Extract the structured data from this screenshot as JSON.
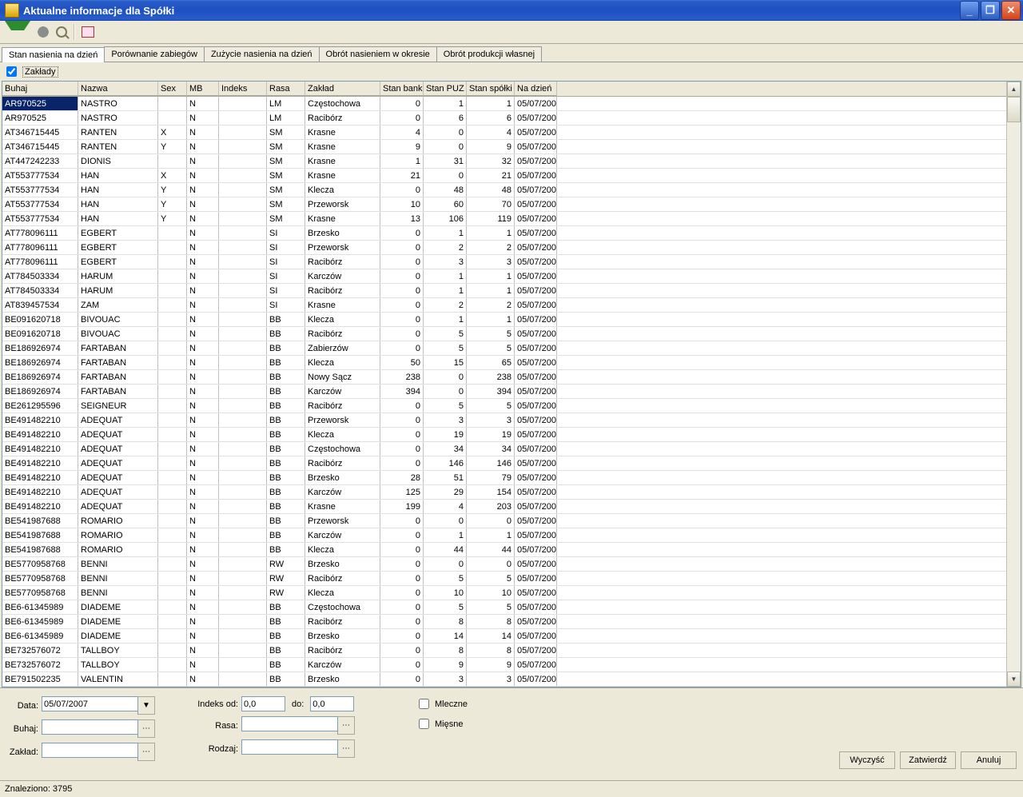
{
  "title": "Aktualne informacje dla Spółki",
  "tabs": [
    "Stan nasienia na dzień",
    "Porównanie zabiegów",
    "Zużycie nasienia na dzień",
    "Obrót nasieniem w okresie",
    "Obrót produkcji własnej"
  ],
  "active_tab": 0,
  "zaklady_checkbox": {
    "label": "Zakłady",
    "checked": true
  },
  "columns": [
    "Buhaj",
    "Nazwa",
    "Sex",
    "MB",
    "Indeks",
    "Rasa",
    "Zakład",
    "Stan bank",
    "Stan PUZ",
    "Stan spółki",
    "Na dzień"
  ],
  "rows": [
    [
      "AR970525",
      "NASTRO",
      "",
      "N",
      "",
      "LM",
      "Częstochowa",
      "0",
      "1",
      "1",
      "05/07/200"
    ],
    [
      "AR970525",
      "NASTRO",
      "",
      "N",
      "",
      "LM",
      "Racibórz",
      "0",
      "6",
      "6",
      "05/07/200"
    ],
    [
      "AT346715445",
      "RANTEN",
      "X",
      "N",
      "",
      "SM",
      "Krasne",
      "4",
      "0",
      "4",
      "05/07/200"
    ],
    [
      "AT346715445",
      "RANTEN",
      "Y",
      "N",
      "",
      "SM",
      "Krasne",
      "9",
      "0",
      "9",
      "05/07/200"
    ],
    [
      "AT447242233",
      "DIONIS",
      "",
      "N",
      "",
      "SM",
      "Krasne",
      "1",
      "31",
      "32",
      "05/07/200"
    ],
    [
      "AT553777534",
      "HAN",
      "X",
      "N",
      "",
      "SM",
      "Krasne",
      "21",
      "0",
      "21",
      "05/07/200"
    ],
    [
      "AT553777534",
      "HAN",
      "Y",
      "N",
      "",
      "SM",
      "Klecza",
      "0",
      "48",
      "48",
      "05/07/200"
    ],
    [
      "AT553777534",
      "HAN",
      "Y",
      "N",
      "",
      "SM",
      "Przeworsk",
      "10",
      "60",
      "70",
      "05/07/200"
    ],
    [
      "AT553777534",
      "HAN",
      "Y",
      "N",
      "",
      "SM",
      "Krasne",
      "13",
      "106",
      "119",
      "05/07/200"
    ],
    [
      "AT778096111",
      "EGBERT",
      "",
      "N",
      "",
      "SI",
      "Brzesko",
      "0",
      "1",
      "1",
      "05/07/200"
    ],
    [
      "AT778096111",
      "EGBERT",
      "",
      "N",
      "",
      "SI",
      "Przeworsk",
      "0",
      "2",
      "2",
      "05/07/200"
    ],
    [
      "AT778096111",
      "EGBERT",
      "",
      "N",
      "",
      "SI",
      "Racibórz",
      "0",
      "3",
      "3",
      "05/07/200"
    ],
    [
      "AT784503334",
      "HARUM",
      "",
      "N",
      "",
      "SI",
      "Karczów",
      "0",
      "1",
      "1",
      "05/07/200"
    ],
    [
      "AT784503334",
      "HARUM",
      "",
      "N",
      "",
      "SI",
      "Racibórz",
      "0",
      "1",
      "1",
      "05/07/200"
    ],
    [
      "AT839457534",
      "ZAM",
      "",
      "N",
      "",
      "SI",
      "Krasne",
      "0",
      "2",
      "2",
      "05/07/200"
    ],
    [
      "BE091620718",
      "BIVOUAC",
      "",
      "N",
      "",
      "BB",
      "Klecza",
      "0",
      "1",
      "1",
      "05/07/200"
    ],
    [
      "BE091620718",
      "BIVOUAC",
      "",
      "N",
      "",
      "BB",
      "Racibórz",
      "0",
      "5",
      "5",
      "05/07/200"
    ],
    [
      "BE186926974",
      "FARTABAN",
      "",
      "N",
      "",
      "BB",
      "Zabierzów",
      "0",
      "5",
      "5",
      "05/07/200"
    ],
    [
      "BE186926974",
      "FARTABAN",
      "",
      "N",
      "",
      "BB",
      "Klecza",
      "50",
      "15",
      "65",
      "05/07/200"
    ],
    [
      "BE186926974",
      "FARTABAN",
      "",
      "N",
      "",
      "BB",
      "Nowy Sącz",
      "238",
      "0",
      "238",
      "05/07/200"
    ],
    [
      "BE186926974",
      "FARTABAN",
      "",
      "N",
      "",
      "BB",
      "Karczów",
      "394",
      "0",
      "394",
      "05/07/200"
    ],
    [
      "BE261295596",
      "SEIGNEUR",
      "",
      "N",
      "",
      "BB",
      "Racibórz",
      "0",
      "5",
      "5",
      "05/07/200"
    ],
    [
      "BE491482210",
      "ADEQUAT",
      "",
      "N",
      "",
      "BB",
      "Przeworsk",
      "0",
      "3",
      "3",
      "05/07/200"
    ],
    [
      "BE491482210",
      "ADEQUAT",
      "",
      "N",
      "",
      "BB",
      "Klecza",
      "0",
      "19",
      "19",
      "05/07/200"
    ],
    [
      "BE491482210",
      "ADEQUAT",
      "",
      "N",
      "",
      "BB",
      "Częstochowa",
      "0",
      "34",
      "34",
      "05/07/200"
    ],
    [
      "BE491482210",
      "ADEQUAT",
      "",
      "N",
      "",
      "BB",
      "Racibórz",
      "0",
      "146",
      "146",
      "05/07/200"
    ],
    [
      "BE491482210",
      "ADEQUAT",
      "",
      "N",
      "",
      "BB",
      "Brzesko",
      "28",
      "51",
      "79",
      "05/07/200"
    ],
    [
      "BE491482210",
      "ADEQUAT",
      "",
      "N",
      "",
      "BB",
      "Karczów",
      "125",
      "29",
      "154",
      "05/07/200"
    ],
    [
      "BE491482210",
      "ADEQUAT",
      "",
      "N",
      "",
      "BB",
      "Krasne",
      "199",
      "4",
      "203",
      "05/07/200"
    ],
    [
      "BE541987688",
      "ROMARIO",
      "",
      "N",
      "",
      "BB",
      "Przeworsk",
      "0",
      "0",
      "0",
      "05/07/200"
    ],
    [
      "BE541987688",
      "ROMARIO",
      "",
      "N",
      "",
      "BB",
      "Karczów",
      "0",
      "1",
      "1",
      "05/07/200"
    ],
    [
      "BE541987688",
      "ROMARIO",
      "",
      "N",
      "",
      "BB",
      "Klecza",
      "0",
      "44",
      "44",
      "05/07/200"
    ],
    [
      "BE5770958768",
      "BENNI",
      "",
      "N",
      "",
      "RW",
      "Brzesko",
      "0",
      "0",
      "0",
      "05/07/200"
    ],
    [
      "BE5770958768",
      "BENNI",
      "",
      "N",
      "",
      "RW",
      "Racibórz",
      "0",
      "5",
      "5",
      "05/07/200"
    ],
    [
      "BE5770958768",
      "BENNI",
      "",
      "N",
      "",
      "RW",
      "Klecza",
      "0",
      "10",
      "10",
      "05/07/200"
    ],
    [
      "BE6-61345989",
      "DIADEME",
      "",
      "N",
      "",
      "BB",
      "Częstochowa",
      "0",
      "5",
      "5",
      "05/07/200"
    ],
    [
      "BE6-61345989",
      "DIADEME",
      "",
      "N",
      "",
      "BB",
      "Racibórz",
      "0",
      "8",
      "8",
      "05/07/200"
    ],
    [
      "BE6-61345989",
      "DIADEME",
      "",
      "N",
      "",
      "BB",
      "Brzesko",
      "0",
      "14",
      "14",
      "05/07/200"
    ],
    [
      "BE732576072",
      "TALLBOY",
      "",
      "N",
      "",
      "BB",
      "Racibórz",
      "0",
      "8",
      "8",
      "05/07/200"
    ],
    [
      "BE732576072",
      "TALLBOY",
      "",
      "N",
      "",
      "BB",
      "Karczów",
      "0",
      "9",
      "9",
      "05/07/200"
    ],
    [
      "BE791502235",
      "VALENTIN",
      "",
      "N",
      "",
      "BB",
      "Brzesko",
      "0",
      "3",
      "3",
      "05/07/200"
    ]
  ],
  "filters": {
    "data_label": "Data:",
    "data_value": "05/07/2007",
    "buhaj_label": "Buhaj:",
    "buhaj_value": "",
    "zaklad_label": "Zakład:",
    "zaklad_value": "",
    "indeks_od_label": "Indeks od:",
    "indeks_od_value": "0,0",
    "do_label": "do:",
    "do_value": "0,0",
    "rasa_label": "Rasa:",
    "rasa_value": "",
    "rodzaj_label": "Rodzaj:",
    "rodzaj_value": "",
    "mleczne_label": "Mleczne",
    "mleczne_checked": false,
    "miesne_label": "Mięsne",
    "miesne_checked": false
  },
  "buttons": {
    "wyczysc": "Wyczyść",
    "zatwierdz": "Zatwierdź",
    "anuluj": "Anuluj"
  },
  "status": "Znaleziono: 3795"
}
